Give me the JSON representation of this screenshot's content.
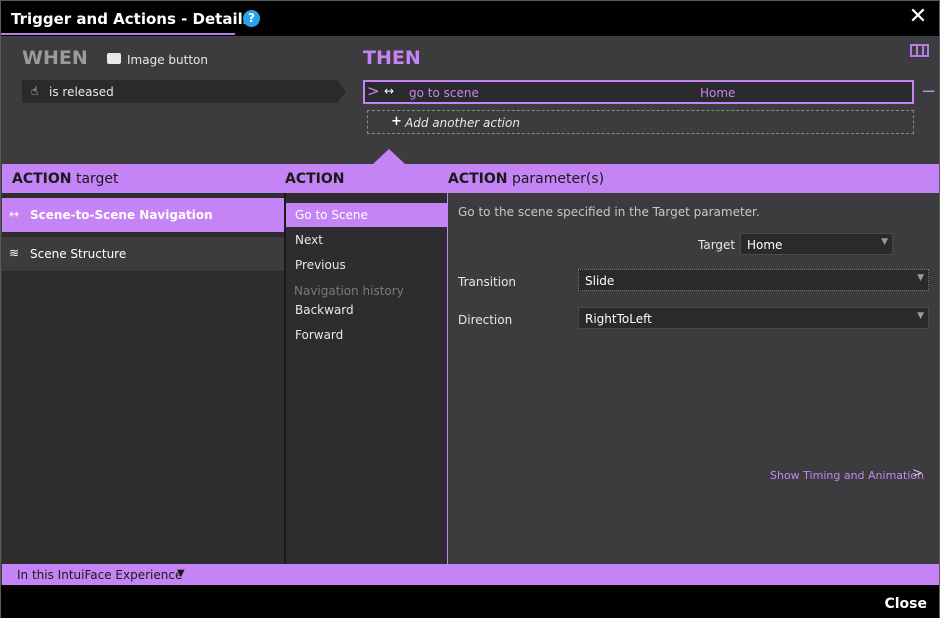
{
  "window": {
    "title": "Trigger and Actions - Details",
    "help_icon": "?",
    "close_icon": "✕"
  },
  "when": {
    "heading": "WHEN",
    "source_label": "Image button",
    "trigger_label": "is released",
    "trigger_icon": "hand-icon",
    "source_icon": "image-button-icon"
  },
  "then": {
    "heading": "THEN",
    "action_name": "go to scene",
    "action_value": "Home",
    "remove_symbol": "−",
    "add_label": "Add another action",
    "add_symbol": "+"
  },
  "band": {
    "col1_bold": "ACTION",
    "col1_rest": "target",
    "col2_bold": "ACTION",
    "col3_bold": "ACTION",
    "col3_rest": "parameter(s)"
  },
  "categories": [
    {
      "label": "Scene-to-Scene Navigation",
      "icon": "↔",
      "selected": true
    },
    {
      "label": "Scene Structure",
      "icon": "≋",
      "selected": false
    }
  ],
  "actions": [
    {
      "label": "Go to Scene",
      "selected": true
    },
    {
      "label": "Next"
    },
    {
      "label": "Previous"
    },
    {
      "label": "Backward"
    },
    {
      "label": "Forward"
    }
  ],
  "action_group_label": "Navigation history",
  "parameters": {
    "description": "Go to the scene specified in the Target parameter.",
    "target_label": "Target",
    "target_value": "Home",
    "transition_label": "Transition",
    "transition_value": "Slide",
    "direction_label": "Direction",
    "direction_value": "RightToLeft",
    "dropdown_arrow": "▼",
    "timing_link": "Show Timing and Animation",
    "timing_chevron": ">"
  },
  "footer": {
    "scope_label": "In this IntuiFace Experience",
    "scope_caret": "▼",
    "close_label": "Close"
  },
  "colors": {
    "accent": "#c584f5",
    "panel": "#3c3c3e",
    "title_bar": "#000000",
    "help": "#2aa3e8"
  }
}
